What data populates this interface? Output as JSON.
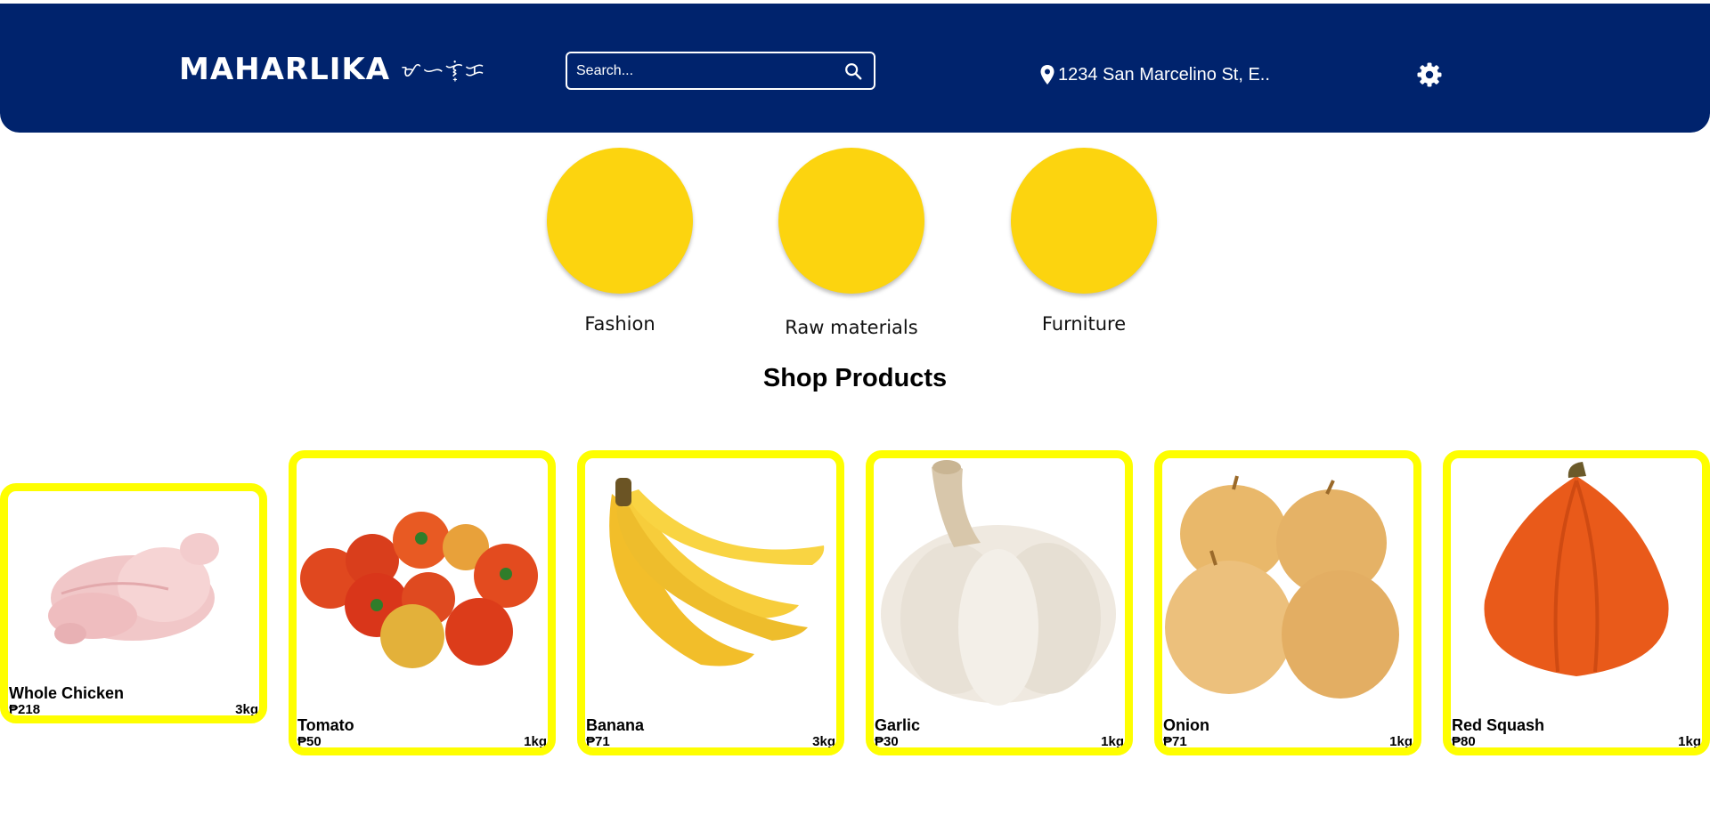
{
  "header": {
    "logo_text": "MAHARLIKA",
    "logo_script": "ᜋᜑᜎ᜔ᜒᜃ",
    "search_placeholder": "Search...",
    "search_icon": "search-icon",
    "address": "1234 San Marcelino St, E..",
    "address_icon": "location-pin-icon",
    "settings_icon": "gear-icon",
    "background_color": "#00236d"
  },
  "categories": [
    {
      "label": "Fashion",
      "color": "#fcd40f"
    },
    {
      "label": "Raw materials",
      "color": "#fcd40f"
    },
    {
      "label": "Furniture",
      "color": "#fcd40f"
    }
  ],
  "section_title": "Shop Products",
  "card_border_color": "#fefe00",
  "products": [
    {
      "name": "Whole Chicken",
      "price": "₱218",
      "weight": "3kg",
      "image": "whole-chicken-image"
    },
    {
      "name": "Tomato",
      "price": "₱50",
      "weight": "1kg",
      "image": "tomato-image"
    },
    {
      "name": "Banana",
      "price": "₱71",
      "weight": "3kg",
      "image": "banana-image"
    },
    {
      "name": "Garlic",
      "price": "₱30",
      "weight": "1kg",
      "image": "garlic-image"
    },
    {
      "name": "Onion",
      "price": "₱71",
      "weight": "1kg",
      "image": "onion-image"
    },
    {
      "name": "Red Squash",
      "price": "₱80",
      "weight": "1kg",
      "image": "red-squash-image"
    }
  ]
}
